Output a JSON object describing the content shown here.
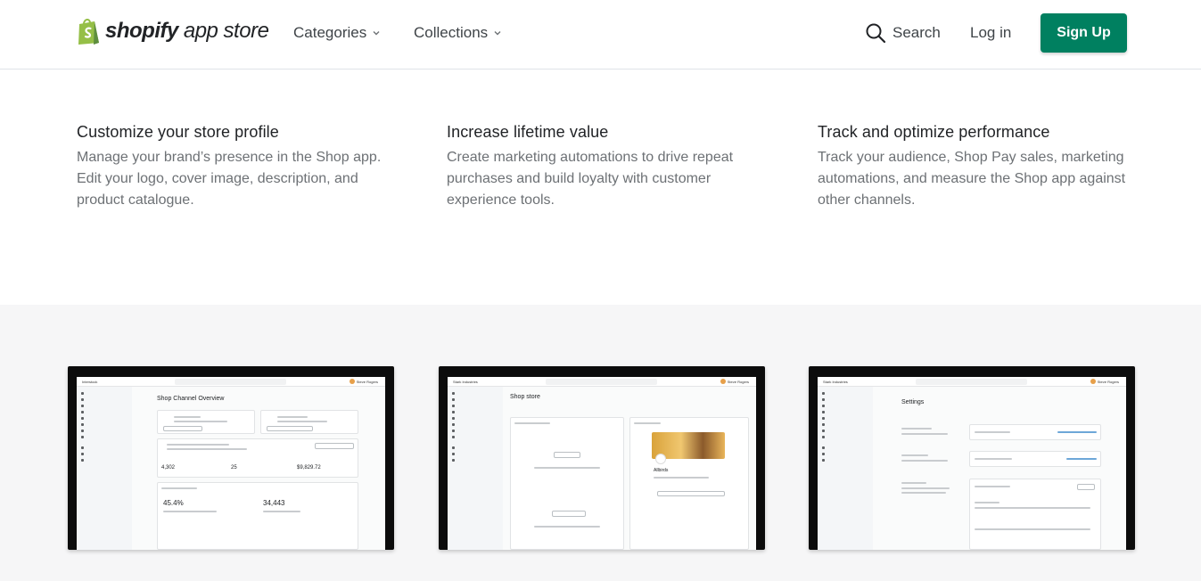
{
  "header": {
    "logo_word": "shopify",
    "logo_sub": "app store",
    "nav": [
      {
        "label": "Categories"
      },
      {
        "label": "Collections"
      }
    ],
    "search_label": "Search",
    "login_label": "Log in",
    "signup_label": "Sign Up",
    "colors": {
      "brand_green": "#008060",
      "logo_green": "#95bf47"
    }
  },
  "features": [
    {
      "title": "Customize your store profile",
      "description": "Manage your brand’s presence in the Shop app. Edit your logo, cover image, description, and product catalogue."
    },
    {
      "title": "Increase lifetime value",
      "description": "Create marketing automations to drive repeat purchases and build loyalty with customer experience tools."
    },
    {
      "title": "Track and optimize performance",
      "description": "Track your audience, Shop Pay sales, marketing automations, and measure the Shop app against other channels."
    }
  ],
  "screenshots": [
    {
      "store": "Interstock",
      "user": "Steve Rogers",
      "heading": "Shop Channel Overview",
      "stats": [
        "4,302",
        "25",
        "$9,829.72"
      ],
      "big_stats": [
        "45.4%",
        "34,443"
      ]
    },
    {
      "store": "Stark Industries",
      "user": "Steve Rogers",
      "heading": "Shop store",
      "brand": "Allbirds"
    },
    {
      "store": "Stark Industries",
      "user": "Steve Rogers",
      "heading": "Settings"
    }
  ]
}
